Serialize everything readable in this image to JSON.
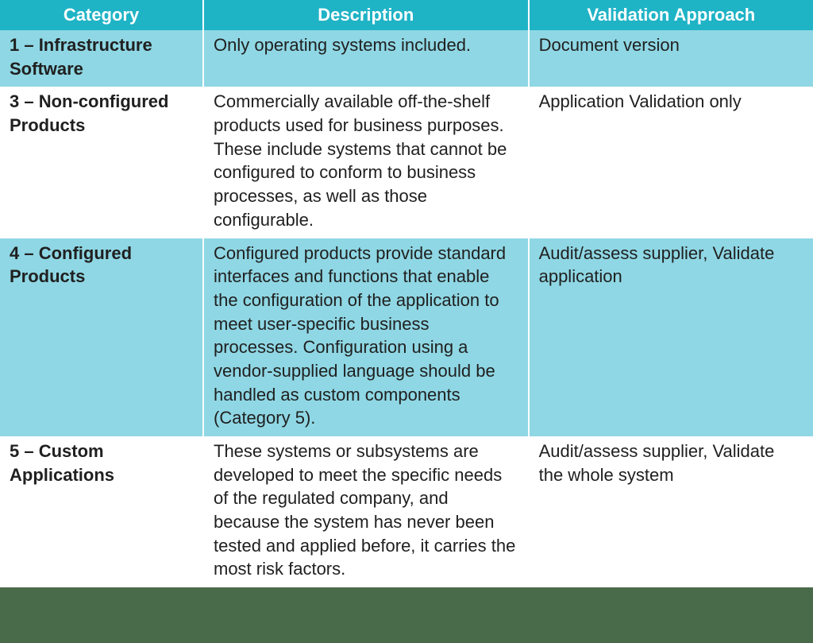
{
  "headers": {
    "category": "Category",
    "description": "Description",
    "validation": "Validation Approach"
  },
  "rows": [
    {
      "category": "1 – Infrastructure Software",
      "description": "Only operating systems included.",
      "validation": "Document version"
    },
    {
      "category": "3 – Non-configured Products",
      "description": "Commercially available off-the-shelf products used for business purposes. These include systems that cannot be configured to conform to business processes, as well as those configurable.",
      "validation": "Application Validation only"
    },
    {
      "category": "4 – Configured Products",
      "description": "Configured products provide standard interfaces and functions that enable the configuration of the application to meet user-specific business processes. Configuration using a vendor-supplied language should be handled as custom components (Category 5).",
      "validation": "Audit/assess supplier, Validate application"
    },
    {
      "category": "5 – Custom Applications",
      "description": "These systems or subsystems are developed to meet the specific needs of the regulated company, and because the system has never been tested and applied before, it carries the most risk factors.",
      "validation": "Audit/assess supplier, Validate the whole system"
    }
  ]
}
